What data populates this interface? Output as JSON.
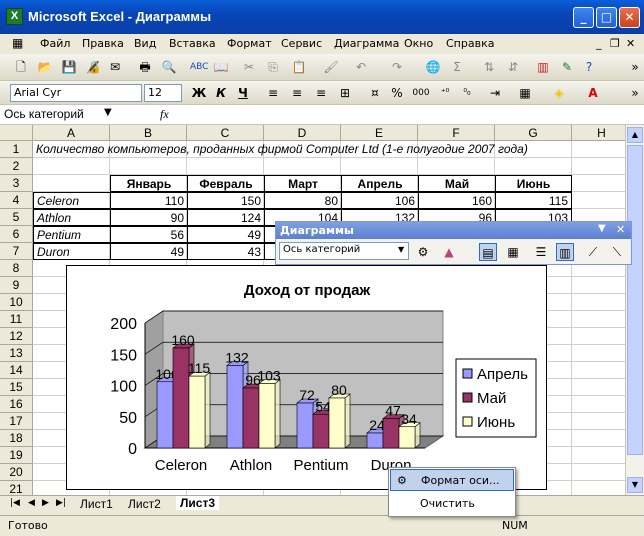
{
  "window": {
    "title": "Microsoft Excel - Диаграммы",
    "app_icon": "excel-icon"
  },
  "menu": [
    "Файл",
    "Правка",
    "Вид",
    "Вставка",
    "Формат",
    "Сервис",
    "Диаграмма",
    "Окно",
    "Справка"
  ],
  "format_bar": {
    "font": "Arial Cyr",
    "size": "12",
    "bold": "Ж",
    "italic": "К",
    "underline": "Ч",
    "percent": "%",
    "thousands": "000"
  },
  "formula_bar": {
    "name_box": "Ось категорий",
    "fx": "fx",
    "content": ""
  },
  "columns": [
    "A",
    "B",
    "C",
    "D",
    "E",
    "F",
    "G",
    "H"
  ],
  "rows": [
    "1",
    "2",
    "3",
    "4",
    "5",
    "6",
    "7",
    "8",
    "9",
    "10",
    "11",
    "12",
    "13",
    "14",
    "15",
    "16",
    "17",
    "18",
    "19",
    "20",
    "21"
  ],
  "cells": {
    "A1": "Количество компьютеров, проданных фирмой Computer Ltd (1-е полугодие 2007 года)",
    "headers": [
      "Январь",
      "Февраль",
      "Март",
      "Апрель",
      "Май",
      "Июнь"
    ],
    "table": [
      {
        "name": "Celeron",
        "values": [
          "110",
          "150",
          "80",
          "106",
          "160",
          "115"
        ]
      },
      {
        "name": "Athlon",
        "values": [
          "90",
          "124",
          "104",
          "132",
          "96",
          "103"
        ]
      },
      {
        "name": "Pentium",
        "values": [
          "56",
          "49",
          "",
          "",
          "",
          ""
        ]
      },
      {
        "name": "Duron",
        "values": [
          "49",
          "43",
          "",
          "",
          "",
          ""
        ]
      }
    ],
    "partial_visible": {
      "D5": "104",
      "E5": "132",
      "F5": "96",
      "G5": "103"
    }
  },
  "chart_toolbar": {
    "title": "Диаграммы",
    "dropdown": "Ось категорий"
  },
  "chart_data": {
    "type": "bar",
    "title": "Доход от продаж",
    "categories": [
      "Celeron",
      "Athlon",
      "Pentium",
      "Duron"
    ],
    "series": [
      {
        "name": "Апрель",
        "values": [
          106,
          132,
          72,
          24
        ]
      },
      {
        "name": "Май",
        "values": [
          160,
          96,
          54,
          47
        ]
      },
      {
        "name": "Июнь",
        "values": [
          115,
          103,
          80,
          34
        ]
      }
    ],
    "ylim": [
      0,
      200
    ],
    "yticks": [
      "0",
      "50",
      "100",
      "150",
      "200"
    ],
    "labels": [
      [
        "106",
        "160",
        "115"
      ],
      [
        "132",
        "96",
        "103"
      ],
      [
        "72",
        "54",
        "80"
      ],
      [
        "24",
        "47",
        "34"
      ]
    ],
    "colors": [
      "#9999ff",
      "#993366",
      "#ffffcc"
    ],
    "legend": "right"
  },
  "context_menu": {
    "items": [
      "Формат оси...",
      "Очистить"
    ]
  },
  "tabs": [
    "Лист1",
    "Лист2",
    "Лист3"
  ],
  "status": {
    "left": "Готово",
    "num": "NUM"
  }
}
